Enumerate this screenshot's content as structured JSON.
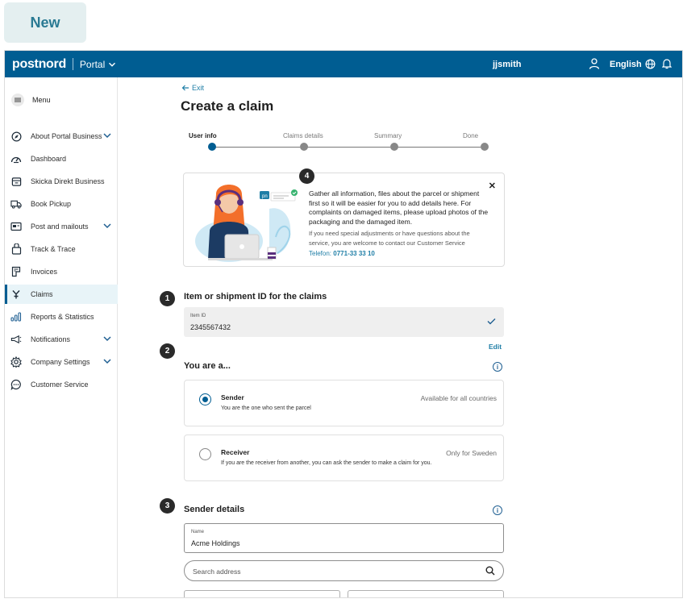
{
  "badge": {
    "label": "New"
  },
  "topbar": {
    "logo": "postnord",
    "portal_label": "Portal",
    "username": "jjsmith",
    "language": "English"
  },
  "sidebar": {
    "menu_label": "Menu",
    "items": [
      {
        "label": "About Portal Business",
        "icon": "compass-icon",
        "expandable": true
      },
      {
        "label": "Dashboard",
        "icon": "gauge-icon",
        "expandable": false
      },
      {
        "label": "Skicka Direkt Business",
        "icon": "package-icon",
        "expandable": false
      },
      {
        "label": "Book Pickup",
        "icon": "truck-icon",
        "expandable": false
      },
      {
        "label": "Post and mailouts",
        "icon": "mail-icon",
        "expandable": true
      },
      {
        "label": "Track & Trace",
        "icon": "parcel-icon",
        "expandable": false
      },
      {
        "label": "Invoices",
        "icon": "invoice-icon",
        "expandable": false
      },
      {
        "label": "Claims",
        "icon": "claims-icon",
        "expandable": false,
        "active": true
      },
      {
        "label": "Reports & Statistics",
        "icon": "bar-chart-icon",
        "expandable": false
      },
      {
        "label": "Notifications",
        "icon": "megaphone-icon",
        "expandable": true
      },
      {
        "label": "Company Settings",
        "icon": "gear-icon",
        "expandable": true
      },
      {
        "label": "Customer Service",
        "icon": "chat-icon",
        "expandable": false
      }
    ]
  },
  "main": {
    "exit_label": "Exit",
    "title": "Create a claim",
    "steps": [
      {
        "label": "User info",
        "active": true
      },
      {
        "label": "Claims details",
        "active": false
      },
      {
        "label": "Summary",
        "active": false
      },
      {
        "label": "Done",
        "active": false
      }
    ],
    "info": {
      "text": "Gather all information, files about the parcel or shipment first so it will be easier for you to add details here. For complaints on damaged items, please upload photos of the packaging and the damaged item.",
      "subtext": "If you need special adjustments or have questions about the service, you are welcome to contact our Customer Service",
      "phone_label": "Telefon:",
      "phone_number": "0771-33 33 10"
    },
    "badges": [
      "1",
      "2",
      "3",
      "4"
    ],
    "item_section": {
      "title": "Item or shipment ID for the claims",
      "field_label": "Item ID",
      "field_value": "2345567432",
      "edit_label": "Edit"
    },
    "role_section": {
      "title": "You are a...",
      "options": [
        {
          "title": "Sender",
          "description": "You are the one who sent the parcel",
          "note": "Available for all countries",
          "selected": true
        },
        {
          "title": "Receiver",
          "description": "If you are the receiver from another, you can ask the sender to make a claim for you.",
          "note": "Only for Sweden",
          "selected": false
        }
      ]
    },
    "sender_section": {
      "title": "Sender details",
      "name_label": "Name",
      "name_value": "Acme Holdings",
      "search_placeholder": "Search address"
    }
  },
  "colors": {
    "brand": "#005d92",
    "link": "#1f7ea6",
    "badge_bg": "#e4eff0",
    "badge_text": "#2a7a93"
  }
}
